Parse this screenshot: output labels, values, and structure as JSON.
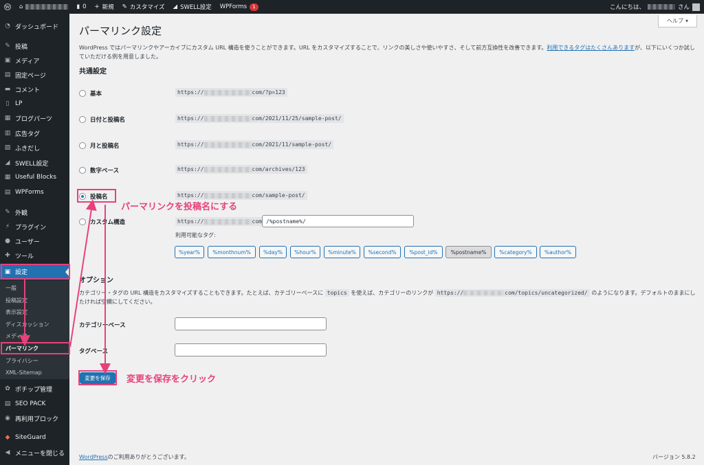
{
  "admin_bar": {
    "comments_count": "0",
    "new_label": "新規",
    "customize_label": "カスタマイズ",
    "swell_label": "SWELL設定",
    "wpforms_label": "WPForms",
    "wpforms_badge": "1",
    "greeting": "こんにちは、",
    "greeting_suffix": "さん"
  },
  "sidebar": {
    "items": [
      {
        "label": "ダッシュボード",
        "icon": "dashboard-icon"
      },
      {
        "label": "投稿",
        "icon": "pin-icon"
      },
      {
        "label": "メディア",
        "icon": "media-icon"
      },
      {
        "label": "固定ページ",
        "icon": "page-icon"
      },
      {
        "label": "コメント",
        "icon": "comment-icon"
      },
      {
        "label": "LP",
        "icon": "document-icon"
      },
      {
        "label": "ブログパーツ",
        "icon": "block-icon"
      },
      {
        "label": "広告タグ",
        "icon": "ad-icon"
      },
      {
        "label": "ふきだし",
        "icon": "balloon-icon"
      },
      {
        "label": "SWELL設定",
        "icon": "swell-icon"
      },
      {
        "label": "Useful Blocks",
        "icon": "block-icon"
      },
      {
        "label": "WPForms",
        "icon": "forms-icon"
      },
      {
        "label": "外観",
        "icon": "brush-icon"
      },
      {
        "label": "プラグイン",
        "icon": "plugin-icon"
      },
      {
        "label": "ユーザー",
        "icon": "user-icon"
      },
      {
        "label": "ツール",
        "icon": "wrench-icon"
      },
      {
        "label": "設定",
        "icon": "settings-icon"
      },
      {
        "label": "ポチップ管理",
        "icon": "paw-icon"
      },
      {
        "label": "SEO PACK",
        "icon": "seo-icon"
      },
      {
        "label": "再利用ブロック",
        "icon": "reuse-icon"
      },
      {
        "label": "SiteGuard",
        "icon": "guard-icon"
      },
      {
        "label": "メニューを閉じる",
        "icon": "collapse-icon"
      }
    ],
    "submenu": [
      "一般",
      "投稿設定",
      "表示設定",
      "ディスカッション",
      "メディア",
      "パーマリンク",
      "プライバシー",
      "XML-Sitemap"
    ]
  },
  "help_label": "ヘルプ",
  "page_title": "パーマリンク設定",
  "intro_text": "WordPress ではパーマリンクやアーカイブにカスタム URL 構造を使うことができます。URL をカスタマイズすることで、リンクの美しさや使いやすさ、そして前方互換性を改善できます。",
  "intro_link": "利用できるタグはたくさんあります",
  "intro_suffix": "が、以下にいくつか試していただける例を用意しました。",
  "common_settings_title": "共通設定",
  "url_prefix": "https://",
  "permalink_options": [
    {
      "label": "基本",
      "suffix": "com/?p=123",
      "checked": false
    },
    {
      "label": "日付と投稿名",
      "suffix": "com/2021/11/25/sample-post/",
      "checked": false
    },
    {
      "label": "月と投稿名",
      "suffix": "com/2021/11/sample-post/",
      "checked": false
    },
    {
      "label": "数字ベース",
      "suffix": "com/archives/123",
      "checked": false
    },
    {
      "label": "投稿名",
      "suffix": "com/sample-post/",
      "checked": true
    }
  ],
  "custom_structure": {
    "label": "カスタム構造",
    "prefix_suffix": "com",
    "value": "/%postname%/"
  },
  "available_tags_label": "利用可能なタグ:",
  "tags": [
    "%year%",
    "%monthnum%",
    "%day%",
    "%hour%",
    "%minute%",
    "%second%",
    "%post_id%",
    "%postname%",
    "%category%",
    "%author%"
  ],
  "active_tag": "%postname%",
  "options_title": "オプション",
  "options_desc_1": "カテゴリー・タグの URL 構造をカスタマイズすることもできます。たとえば、カテゴリーベースに",
  "options_code": "topics",
  "options_desc_2": "を使えば、カテゴリーのリンクが",
  "options_code2_prefix": "https://",
  "options_code2_suffix": "com/topics/uncategorized/",
  "options_desc_3": "のようになります。デフォルトのままにしたければ空欄にしてください。",
  "category_base_label": "カテゴリーベース",
  "tag_base_label": "タグベース",
  "save_button_label": "変更を保存",
  "footer_link": "WordPress",
  "footer_text": "のご利用ありがとうございます。",
  "version_text": "バージョン 5.8.2",
  "annotations": {
    "postname": "パーマリンクを投稿名にする",
    "save": "変更を保存をクリック"
  },
  "annotation_color": "#e8407a",
  "accent_color": "#2271b1"
}
